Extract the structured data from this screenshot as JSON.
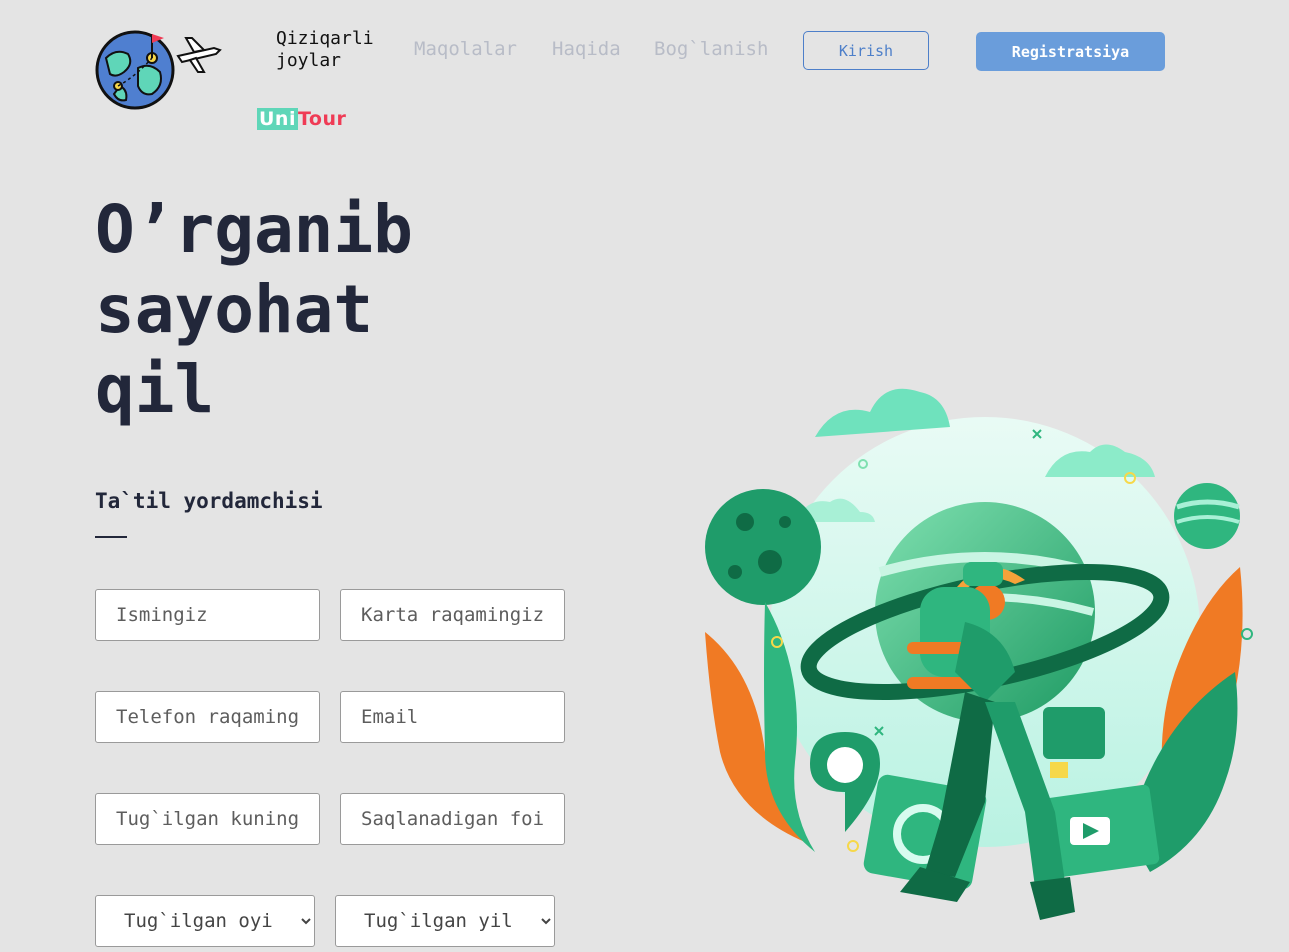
{
  "header": {
    "logo": {
      "part1": "Uni",
      "part2": "Tour"
    },
    "nav": {
      "active": "Qiziqarli joylar",
      "links": [
        "Maqolalar",
        "Haqida",
        "Bog`lanish"
      ]
    },
    "login_label": "Kirish",
    "register_label": "Registratsiya"
  },
  "hero": {
    "title": "O’rganib\nsayohat\nqil"
  },
  "form": {
    "title": "Ta`til yordamchisi",
    "fields": {
      "name": "Ismingiz",
      "card": "Karta raqamingiz",
      "phone": "Telefon raqamingiz",
      "email": "Email",
      "birthday": "Tug`ilgan kuningiz",
      "saving": "Saqlanadigan foiz"
    },
    "selects": {
      "month": "Tug`ilgan oyi",
      "year": "Tug`ilgan yil"
    }
  },
  "colors": {
    "background": "#e4e4e4",
    "accent_blue": "#6a9ddb",
    "green": "#2fb67f",
    "orange": "#f07a24"
  },
  "icons": [
    "globe-logo-icon",
    "airplane-icon",
    "chevron-down-icon",
    "traveler-illustration"
  ]
}
